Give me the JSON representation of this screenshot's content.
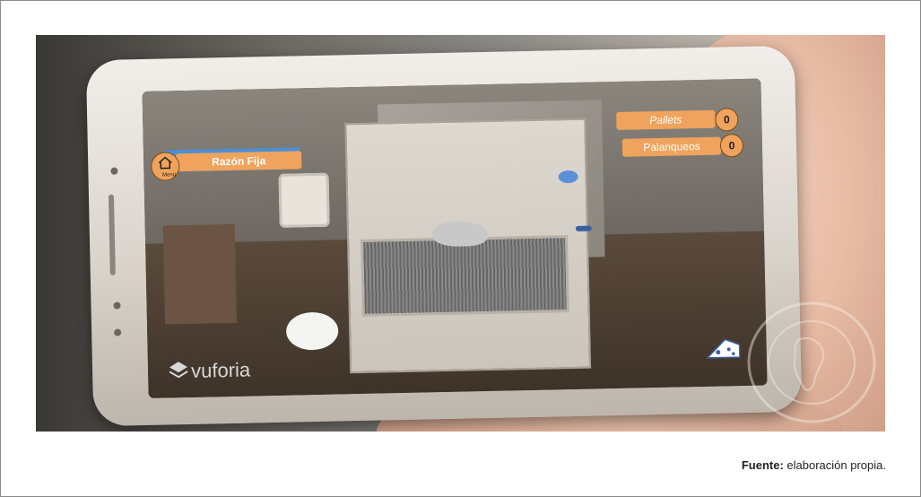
{
  "figure": {
    "caption_bold": "Fuente:",
    "caption_rest": " elaboración propia."
  },
  "app": {
    "menu_label": "Menú",
    "mode_label": "Razón Fija",
    "pallets_label": "Pallets",
    "pallets_count": "0",
    "palancas_label": "Palanqueos",
    "palancas_count": "0",
    "brand": "vuforia"
  },
  "colors": {
    "accent": "#f0a35c",
    "menu_bar": "#4b8fd6"
  },
  "icons": [
    "home-icon",
    "cheese-icon",
    "vuforia-logo-icon",
    "unam-seal-icon"
  ]
}
